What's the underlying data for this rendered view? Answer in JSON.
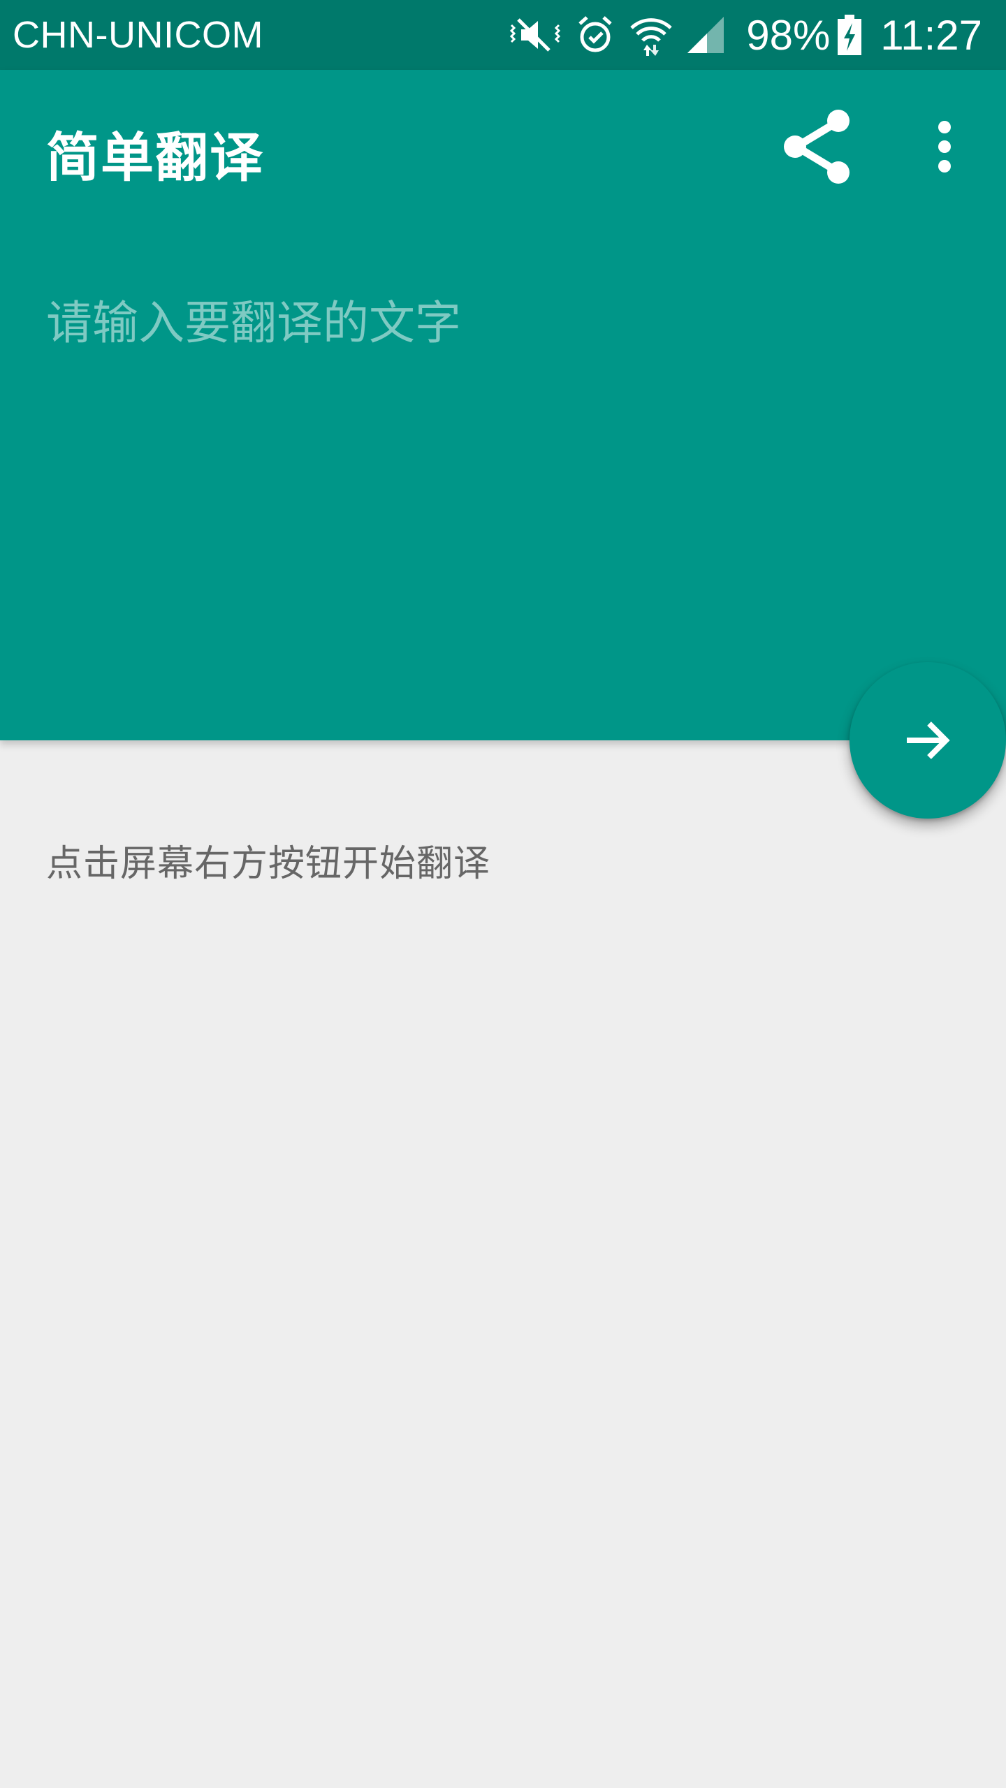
{
  "status_bar": {
    "carrier": "CHN-UNICOM",
    "battery_percent": "98%",
    "time": "11:27",
    "icons": [
      "mute-vibrate-icon",
      "alarm-icon",
      "wifi-icon",
      "signal-icon",
      "battery-charging-icon"
    ]
  },
  "app_bar": {
    "title": "简单翻译",
    "actions": [
      "share-icon",
      "more-vert-icon"
    ]
  },
  "input": {
    "value": "",
    "placeholder": "请输入要翻译的文字"
  },
  "fab": {
    "icon": "arrow-forward-icon"
  },
  "result": {
    "text": "点击屏幕右方按钮开始翻译"
  },
  "colors": {
    "primary": "#009688",
    "primary_dark": "#00796b",
    "background": "#eeeeee",
    "placeholder": "#7fcac3",
    "result_text": "#666666"
  }
}
